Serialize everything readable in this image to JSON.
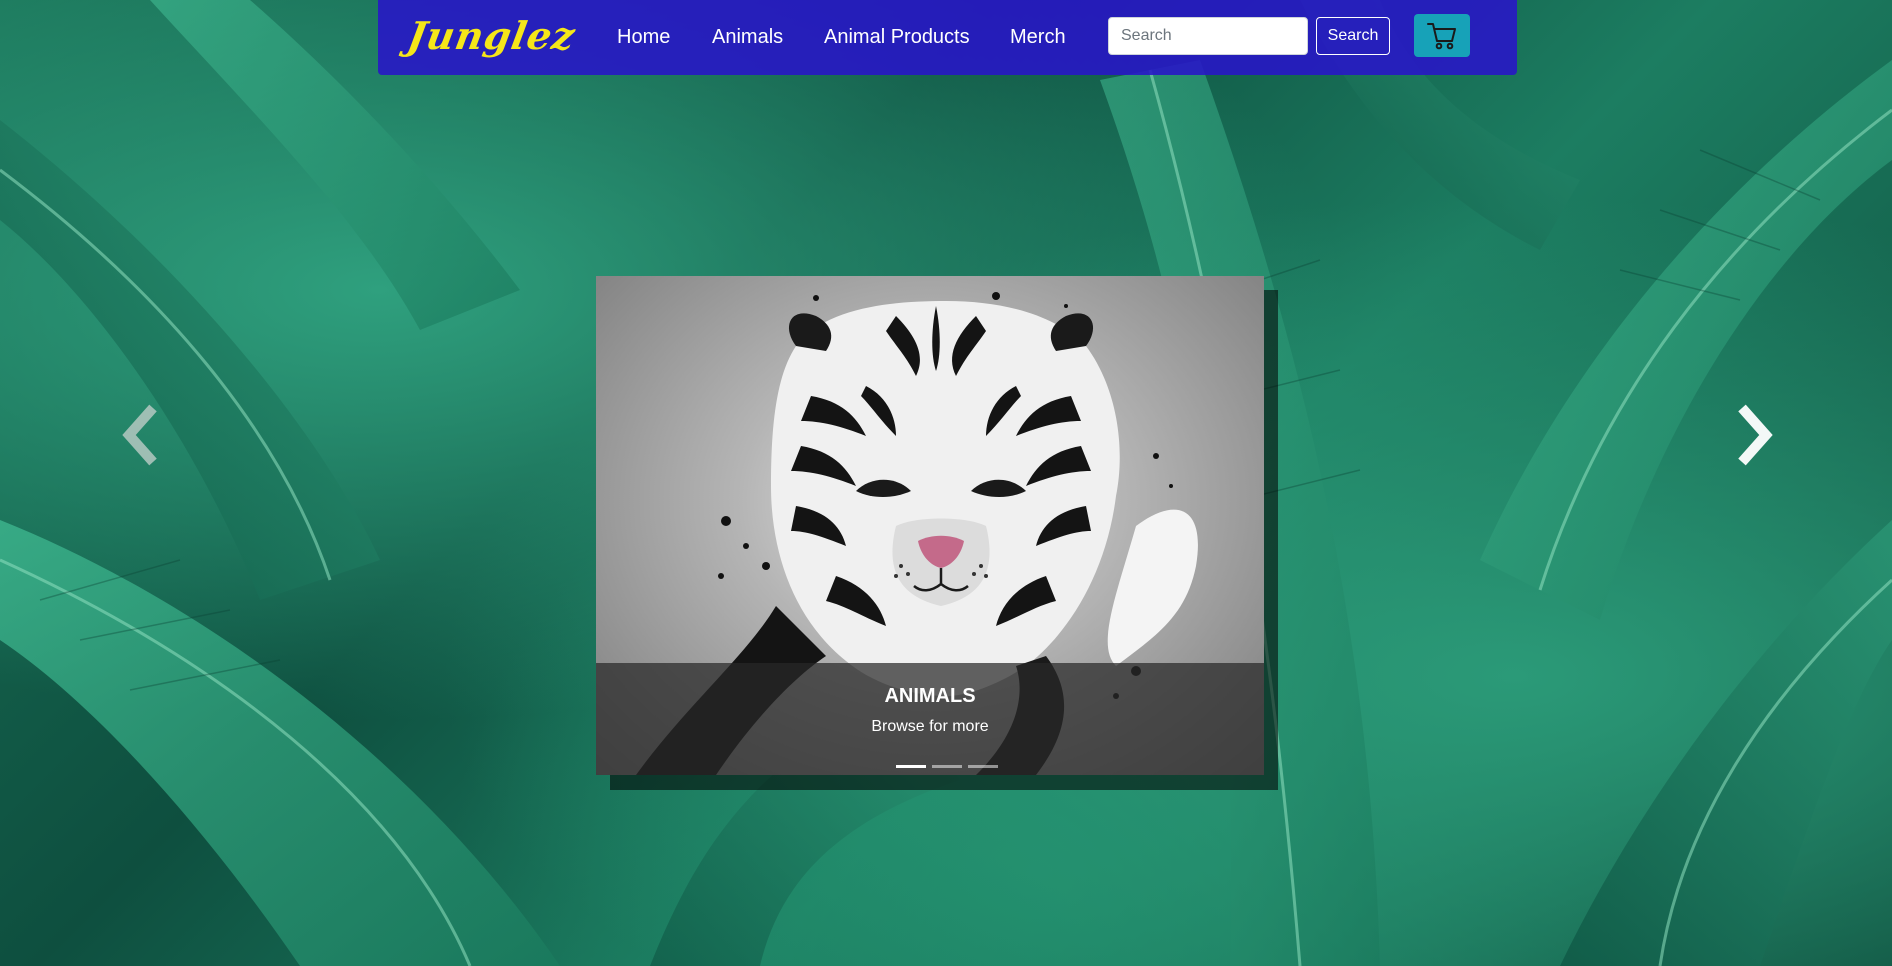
{
  "navbar": {
    "brand": "Junglez",
    "links": [
      "Home",
      "Animals",
      "Animal Products",
      "Merch"
    ],
    "search": {
      "placeholder": "Search",
      "value": "",
      "button_label": "Search"
    },
    "cart_icon": "cart-icon",
    "background_color": "#2814c8",
    "brand_color": "#f5e619",
    "cart_color": "#17a2b8"
  },
  "carousel": {
    "caption_title": "ANIMALS",
    "caption_text": "Browse for more",
    "image": "tiger-illustration",
    "slide_count": 3,
    "active_slide": 1,
    "prev_icon": "chevron-left-icon",
    "next_icon": "chevron-right-icon"
  },
  "background": {
    "image": "tropical-leaves"
  }
}
